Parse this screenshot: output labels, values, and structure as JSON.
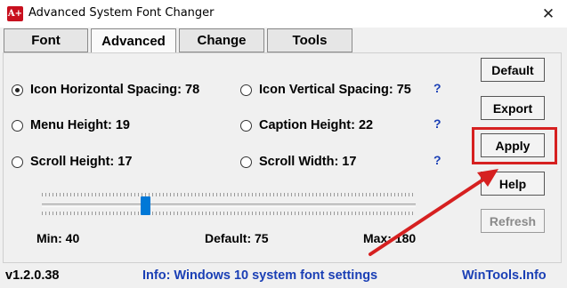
{
  "window": {
    "title": "Advanced System Font Changer",
    "icon_text": "A+",
    "close_glyph": "✕"
  },
  "tabs": [
    {
      "label": "Font"
    },
    {
      "label": "Advanced"
    },
    {
      "label": "Change"
    },
    {
      "label": "Tools"
    }
  ],
  "settings": [
    {
      "label": "Icon Horizontal Spacing: 78",
      "checked": true
    },
    {
      "label": "Icon Vertical Spacing: 75",
      "checked": false
    },
    {
      "label": "Menu Height: 19",
      "checked": false
    },
    {
      "label": "Caption Height: 22",
      "checked": false
    },
    {
      "label": "Scroll Height: 17",
      "checked": false
    },
    {
      "label": "Scroll Width: 17",
      "checked": false
    }
  ],
  "help_glyph": "?",
  "buttons": {
    "default": "Default",
    "export": "Export",
    "apply": "Apply",
    "help": "Help",
    "refresh": "Refresh"
  },
  "slider": {
    "min_label": "Min: 40",
    "default_label": "Default: 75",
    "max_label": "Max: 180",
    "min": 40,
    "max": 180,
    "value": 78
  },
  "status": {
    "version": "v1.2.0.38",
    "info": "Info: Windows 10 system font settings",
    "website": "WinTools.Info"
  },
  "colors": {
    "accent": "#0078d7",
    "info_text": "#1a3fb5",
    "annotation_red": "#d62020"
  }
}
